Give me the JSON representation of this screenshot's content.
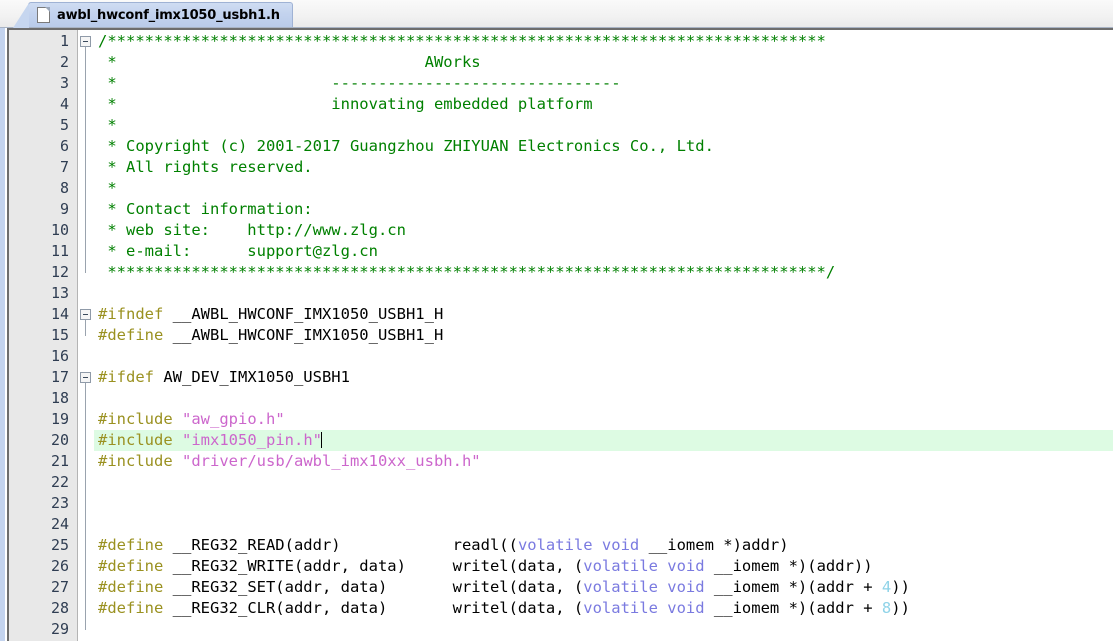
{
  "tab": {
    "filename": "awbl_hwconf_imx1050_usbh1.h",
    "icon": "file-icon"
  },
  "editor": {
    "current_line": 20,
    "first_visible_line": 1,
    "last_visible_line": 29,
    "colors": {
      "comment": "#008000",
      "preprocessor": "#9a9120",
      "string": "#cc66cc",
      "keyword": "#7a7ae0",
      "number": "#8fd3e8",
      "plain": "#000000",
      "current_line_highlight": "#ddfbe3",
      "gutter_background": "#e8e8e8",
      "tab_background": "#c3d3ee"
    },
    "lines": [
      {
        "n": 1,
        "fold": "collapse",
        "tokens": [
          {
            "t": "/",
            "c": "comment"
          },
          {
            "t": "*****************************************************************************",
            "c": "comment"
          }
        ]
      },
      {
        "n": 2,
        "tokens": [
          {
            "t": " *                                 AWorks",
            "c": "comment"
          }
        ]
      },
      {
        "n": 3,
        "tokens": [
          {
            "t": " *                       -------------------------------",
            "c": "comment"
          }
        ]
      },
      {
        "n": 4,
        "tokens": [
          {
            "t": " *                       innovating embedded platform",
            "c": "comment"
          }
        ]
      },
      {
        "n": 5,
        "tokens": [
          {
            "t": " *",
            "c": "comment"
          }
        ]
      },
      {
        "n": 6,
        "tokens": [
          {
            "t": " * Copyright (c) 2001-2017 Guangzhou ZHIYUAN Electronics Co., Ltd.",
            "c": "comment"
          }
        ]
      },
      {
        "n": 7,
        "tokens": [
          {
            "t": " * All rights reserved.",
            "c": "comment"
          }
        ]
      },
      {
        "n": 8,
        "tokens": [
          {
            "t": " *",
            "c": "comment"
          }
        ]
      },
      {
        "n": 9,
        "tokens": [
          {
            "t": " * Contact information:",
            "c": "comment"
          }
        ]
      },
      {
        "n": 10,
        "tokens": [
          {
            "t": " * web site:    http://www.zlg.cn",
            "c": "comment"
          }
        ]
      },
      {
        "n": 11,
        "tokens": [
          {
            "t": " * e-mail:      support@zlg.cn",
            "c": "comment"
          }
        ]
      },
      {
        "n": 12,
        "tokens": [
          {
            "t": " *****************************************************************************/",
            "c": "comment"
          }
        ]
      },
      {
        "n": 13,
        "tokens": []
      },
      {
        "n": 14,
        "fold": "collapse",
        "tokens": [
          {
            "t": "#ifndef",
            "c": "preprocessor"
          },
          {
            "t": " __AWBL_HWCONF_IMX1050_USBH1_H",
            "c": "plain"
          }
        ]
      },
      {
        "n": 15,
        "tokens": [
          {
            "t": "#define",
            "c": "preprocessor"
          },
          {
            "t": " __AWBL_HWCONF_IMX1050_USBH1_H",
            "c": "plain"
          }
        ]
      },
      {
        "n": 16,
        "tokens": []
      },
      {
        "n": 17,
        "fold": "collapse",
        "tokens": [
          {
            "t": "#ifdef",
            "c": "preprocessor"
          },
          {
            "t": " AW_DEV_IMX1050_USBH1",
            "c": "plain"
          }
        ]
      },
      {
        "n": 18,
        "tokens": []
      },
      {
        "n": 19,
        "tokens": [
          {
            "t": "#include",
            "c": "preprocessor"
          },
          {
            "t": " ",
            "c": "plain"
          },
          {
            "t": "\"aw_gpio.h\"",
            "c": "string"
          }
        ]
      },
      {
        "n": 20,
        "current": true,
        "tokens": [
          {
            "t": "#include",
            "c": "preprocessor"
          },
          {
            "t": " ",
            "c": "plain"
          },
          {
            "t": "\"imx1050_pin.h\"",
            "c": "string"
          },
          {
            "t": "",
            "c": "caret"
          }
        ]
      },
      {
        "n": 21,
        "tokens": [
          {
            "t": "#include",
            "c": "preprocessor"
          },
          {
            "t": " ",
            "c": "plain"
          },
          {
            "t": "\"driver/usb/awbl_imx10xx_usbh.h\"",
            "c": "string"
          }
        ]
      },
      {
        "n": 22,
        "tokens": []
      },
      {
        "n": 23,
        "tokens": []
      },
      {
        "n": 24,
        "tokens": []
      },
      {
        "n": 25,
        "tokens": [
          {
            "t": "#define",
            "c": "preprocessor"
          },
          {
            "t": " __REG32_READ(addr)            readl((",
            "c": "plain"
          },
          {
            "t": "volatile void",
            "c": "keyword"
          },
          {
            "t": " __iomem *)addr)",
            "c": "plain"
          }
        ]
      },
      {
        "n": 26,
        "tokens": [
          {
            "t": "#define",
            "c": "preprocessor"
          },
          {
            "t": " __REG32_WRITE(addr, data)     writel(data, (",
            "c": "plain"
          },
          {
            "t": "volatile void",
            "c": "keyword"
          },
          {
            "t": " __iomem *)(addr))",
            "c": "plain"
          }
        ]
      },
      {
        "n": 27,
        "tokens": [
          {
            "t": "#define",
            "c": "preprocessor"
          },
          {
            "t": " __REG32_SET(addr, data)       writel(data, (",
            "c": "plain"
          },
          {
            "t": "volatile void",
            "c": "keyword"
          },
          {
            "t": " __iomem *)(addr + ",
            "c": "plain"
          },
          {
            "t": "4",
            "c": "number"
          },
          {
            "t": "))",
            "c": "plain"
          }
        ]
      },
      {
        "n": 28,
        "tokens": [
          {
            "t": "#define",
            "c": "preprocessor"
          },
          {
            "t": " __REG32_CLR(addr, data)       writel(data, (",
            "c": "plain"
          },
          {
            "t": "volatile void",
            "c": "keyword"
          },
          {
            "t": " __iomem *)(addr + ",
            "c": "plain"
          },
          {
            "t": "8",
            "c": "number"
          },
          {
            "t": "))",
            "c": "plain"
          }
        ]
      },
      {
        "n": 29,
        "tokens": []
      }
    ]
  }
}
